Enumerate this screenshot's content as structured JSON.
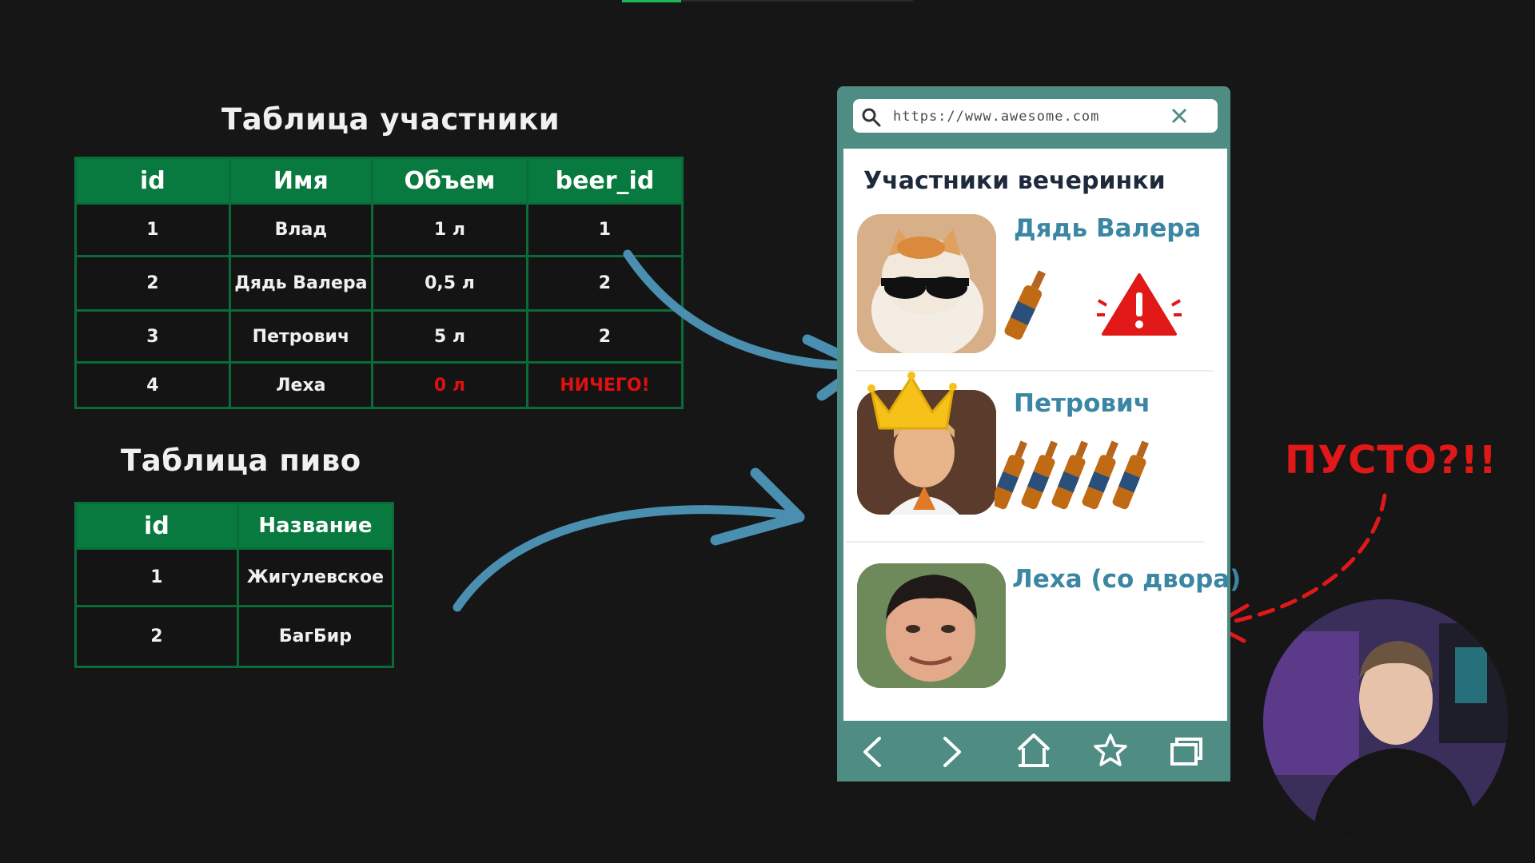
{
  "participants_table": {
    "title": "Таблица участники",
    "headers": [
      "id",
      "Имя",
      "Объем",
      "beer_id"
    ],
    "rows": [
      [
        "1",
        "Влад",
        "1 л",
        "1"
      ],
      [
        "2",
        "Дядь Валера",
        "0,5 л",
        "2"
      ],
      [
        "3",
        "Петрович",
        "5 л",
        "2"
      ],
      [
        "4",
        "Леха",
        "0 л",
        "НИЧЕГО!"
      ]
    ]
  },
  "beer_table": {
    "title": "Таблица пиво",
    "headers": [
      "id",
      "Название"
    ],
    "rows": [
      [
        "1",
        "Жигулевское"
      ],
      [
        "2",
        "БагБир"
      ]
    ]
  },
  "phone": {
    "url": "https://www.awesome.com",
    "screen_title": "Участники вечеринки",
    "people": [
      {
        "name": "Дядь Валера",
        "bottles": 1,
        "warning": true
      },
      {
        "name": "Петрович",
        "bottles": 5,
        "crown": true
      },
      {
        "name": "Леха (со двора)",
        "bottles": 0
      }
    ]
  },
  "callout": "ПУСТО?!!",
  "colors": {
    "table_header": "#087a3f",
    "phone": "#4f8d84",
    "name": "#3b86a3",
    "alert": "#e01010",
    "arrow": "#4a8fb0"
  }
}
